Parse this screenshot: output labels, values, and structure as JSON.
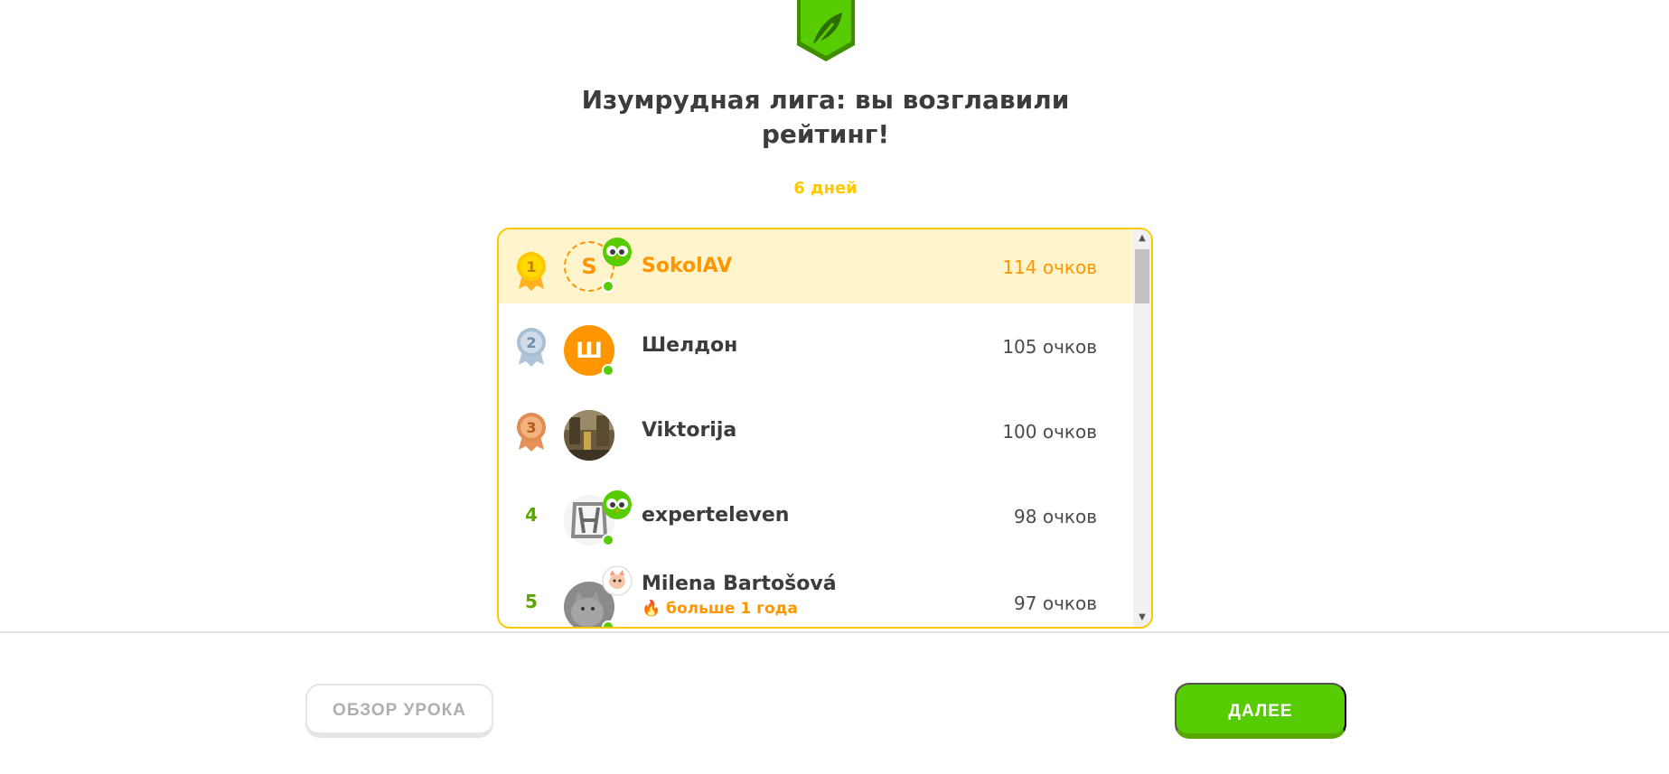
{
  "league": {
    "badge_icon": "emerald-league-feather-icon",
    "title_line1": "Изумрудная лига: вы возглавили",
    "title_line2": "рейтинг!",
    "days_left": "6 дней"
  },
  "colors": {
    "gold": "#ffc800",
    "orange": "#ff9600",
    "green": "#58cc02",
    "highlight": "#fff4cc"
  },
  "leaderboard": [
    {
      "rank": "1",
      "rank_style": "gold-medal",
      "avatar_letter": "S",
      "name": "SokolAV",
      "score": "114 очков",
      "is_me": true
    },
    {
      "rank": "2",
      "rank_style": "silver-medal",
      "avatar_letter": "Ш",
      "name": "Шелдон",
      "score": "105 очков"
    },
    {
      "rank": "3",
      "rank_style": "bronze-medal",
      "avatar_icon": "photo-avatar",
      "name": "Viktorija",
      "score": "100 очков"
    },
    {
      "rank": "4",
      "avatar_icon": "honda-logo-avatar",
      "name": "experteleven",
      "score": "98 очков"
    },
    {
      "rank": "5",
      "avatar_icon": "cat-photo-avatar",
      "name": "Milena Bartošová",
      "streak": "больше 1 года",
      "score": "97 очков"
    }
  ],
  "footer": {
    "review_button": "ОБЗОР УРОКА",
    "continue_button": "ДАЛЕЕ"
  }
}
